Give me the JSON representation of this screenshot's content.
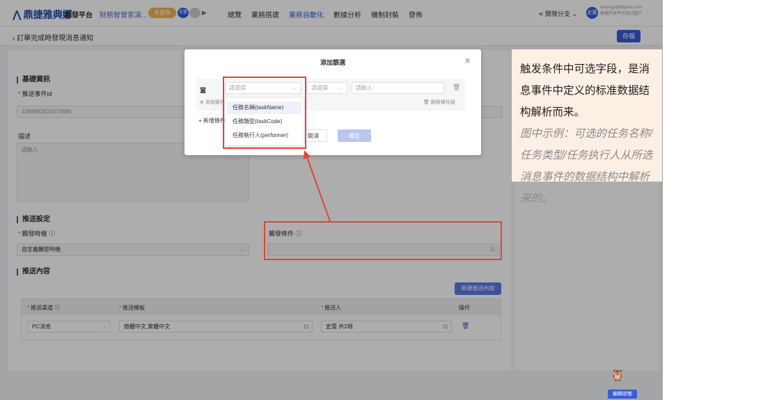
{
  "header": {
    "brand": "鼎捷雅典娜",
    "platform": "開發平台",
    "app_name": "財務智管家演...",
    "chip_label": "未發布",
    "chip_user": "史蕾",
    "play_icon": "play-icon",
    "nav": [
      "總覽",
      "業務搭建",
      "業務自動化",
      "數據分析",
      "機制封裝",
      "發佈"
    ],
    "branch": "開發分支",
    "avatar": "史蕾",
    "user_email": "shinmgx@digiwin.com",
    "user_tenant": "鼎捷开发平台测试租户"
  },
  "subheader": {
    "back_label": "訂單完成時發現消息通知",
    "save_label": "存檔"
  },
  "form": {
    "basic_section": "基礎資訊",
    "event_id_label": "推送事件id",
    "event_id_value": "1088951823474688",
    "desc_label": "描述",
    "desc_placeholder": "請輸入",
    "push_section": "推送設定",
    "trigger_time_label": "觸發時機",
    "trigger_time_value": "自定義觸發時機",
    "trigger_cond_label": "觸發條件",
    "content_section": "推送內容",
    "new_content_button": "新建推送內容",
    "table_headers": [
      "推送渠道",
      "推送模板",
      "推送人",
      "操作"
    ],
    "table_row": {
      "channel": "PC消息",
      "template": "簡體中文,繁體中文",
      "pusher": "史蕾 共2項"
    }
  },
  "modal": {
    "title": "添加篩選",
    "when_label": "當",
    "field_placeholder": "請選擇",
    "operator_placeholder": "請選擇",
    "value_placeholder": "請輸入",
    "add_condition": "添加條件",
    "delete_group": "刪除條件組",
    "add_group": "新增條件",
    "cancel": "取消",
    "confirm": "確定",
    "options": [
      "任務名稱(taskName)",
      "任務類型(taskCode)",
      "任務執行人(performer)"
    ]
  },
  "annotation": {
    "main_text": "触发条件中可选字段，是消息事件中定义的标准数据结构解析而来。",
    "example_text": "图中示例：可选的任务名称/任务类型/任务执行人从所选消息事件的数据结构中解析来的。"
  },
  "footer": {
    "status_label": "編輯狀態"
  }
}
